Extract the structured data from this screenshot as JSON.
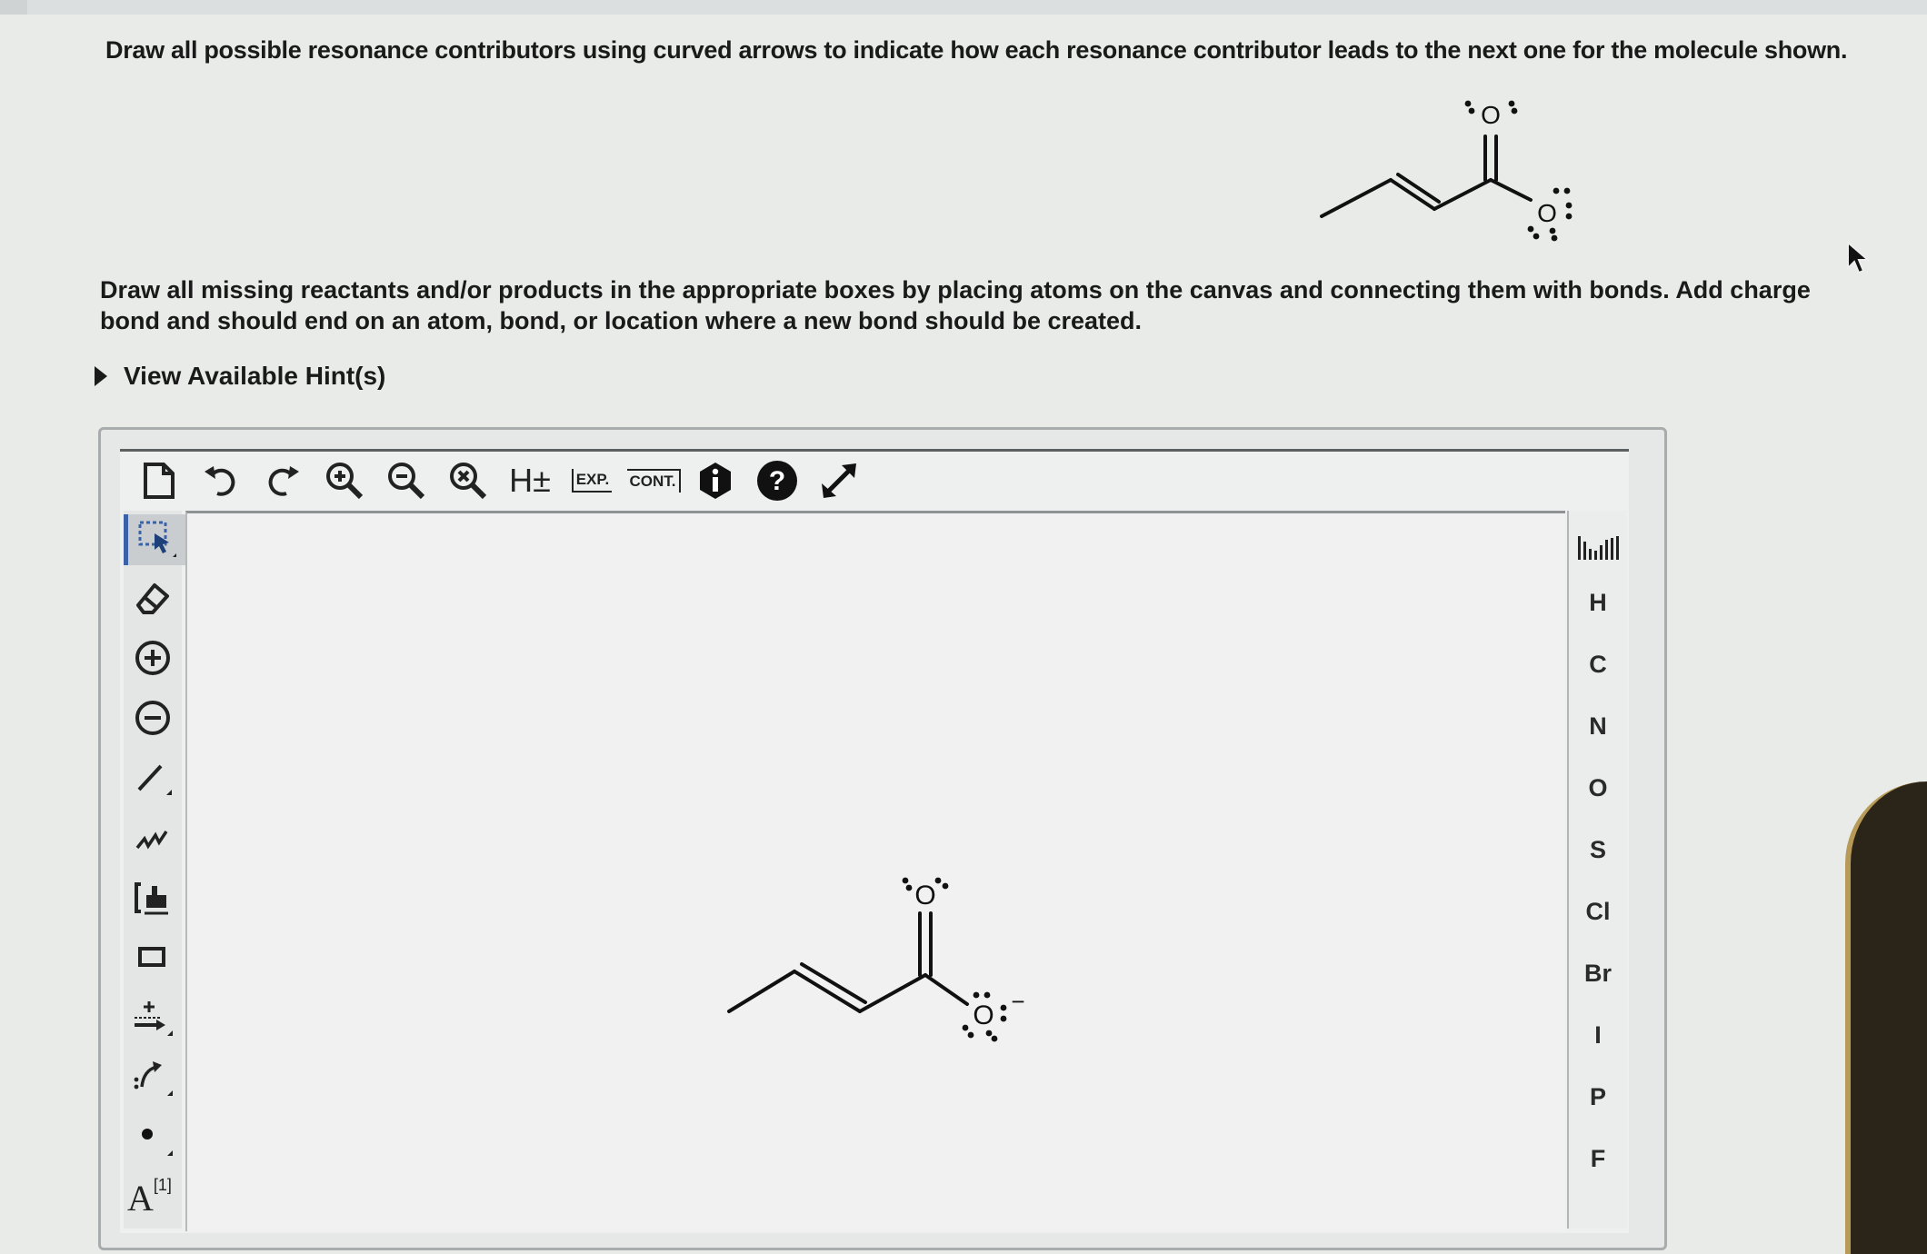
{
  "question": {
    "prompt": "Draw all possible resonance contributors using curved arrows to indicate how each resonance contributor leads to the next one for the molecule shown.",
    "instructions_line1": "Draw all missing reactants and/or products in the appropriate boxes by placing atoms on the canvas and connecting them with bonds. Add charge",
    "instructions_line2": "bond and should end on an atom, bond, or location where a new bond should be created.",
    "hint_link": "View Available Hint(s)"
  },
  "molecule_labels": {
    "oxygen_top": "O",
    "oxygen_single": "O",
    "charge": "−"
  },
  "toolbar": {
    "h_toggle": "H±",
    "exp": "EXP.",
    "cont": "CONT."
  },
  "left_tools": {
    "atom_list_label": "A",
    "atom_list_badge": "[1]"
  },
  "elements": [
    "H",
    "C",
    "N",
    "O",
    "S",
    "Cl",
    "Br",
    "I",
    "P",
    "F"
  ]
}
